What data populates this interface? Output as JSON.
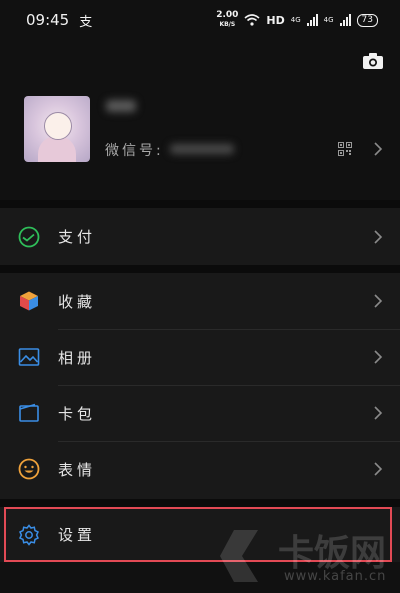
{
  "status_bar": {
    "time": "09:45",
    "notification_glyph": "支",
    "net_speed_value": "2.00",
    "net_speed_unit": "KB/S",
    "hd_label": "HD",
    "sig1_label": "4G",
    "sig2_label": "4G",
    "battery_level": "73"
  },
  "profile": {
    "wechat_id_label": "微信号:"
  },
  "menu": {
    "pay": "支付",
    "favorites": "收藏",
    "album": "相册",
    "cards": "卡包",
    "stickers": "表情",
    "settings": "设置"
  },
  "watermark": {
    "brand": "卡饭网",
    "url": "www.kafan.cn"
  },
  "colors": {
    "background": "#111111",
    "section_bg": "#191919",
    "highlight_border": "#e24a55",
    "pay_icon": "#2fbf5a",
    "blue_icon": "#3a8ee6",
    "sticker_icon": "#f0a23b"
  },
  "icons": {
    "camera": "camera-icon",
    "qr": "qr-code-icon",
    "pay": "wechat-pay-icon",
    "favorites": "cube-icon",
    "album": "image-icon",
    "cards": "wallet-icon",
    "stickers": "smiley-icon",
    "settings": "gear-icon",
    "chevron": "chevron-right-icon"
  }
}
